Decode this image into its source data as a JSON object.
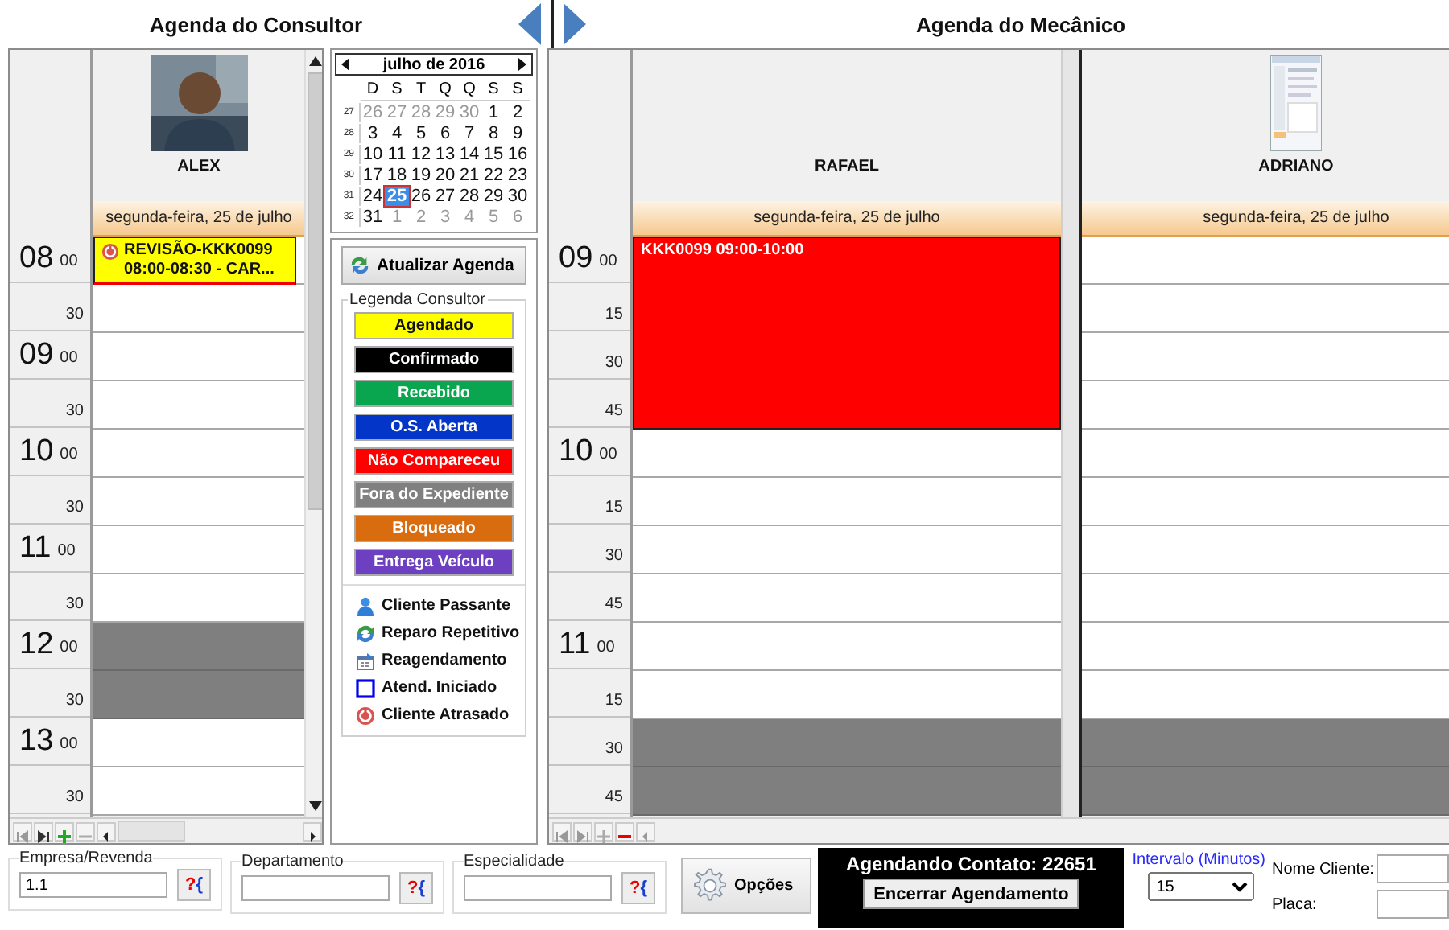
{
  "header": {
    "left_title": "Agenda do Consultor",
    "right_title": "Agenda do Mecânico"
  },
  "consultant_agenda": {
    "times": [
      {
        "hour": "08",
        "minute": "00"
      },
      {
        "minute": "30"
      },
      {
        "hour": "09",
        "minute": "00"
      },
      {
        "minute": "30"
      },
      {
        "hour": "10",
        "minute": "00"
      },
      {
        "minute": "30"
      },
      {
        "hour": "11",
        "minute": "00"
      },
      {
        "minute": "30"
      },
      {
        "hour": "12",
        "minute": "00"
      },
      {
        "minute": "30"
      },
      {
        "hour": "13",
        "minute": "00"
      },
      {
        "minute": "30"
      }
    ],
    "resources": [
      {
        "name": "ALEX",
        "photo": true,
        "date": "segunda-feira, 25 de julho",
        "slots": [
          {
            "blocked": false,
            "appointment": {
              "title": "REVISÃO-KKK0099",
              "detail": "08:00-08:30 - CAR...",
              "color": "#ffff00",
              "late": true
            }
          },
          {
            "blocked": false
          },
          {
            "blocked": false
          },
          {
            "blocked": false
          },
          {
            "blocked": false
          },
          {
            "blocked": false
          },
          {
            "blocked": false
          },
          {
            "blocked": false
          },
          {
            "blocked": true
          },
          {
            "blocked": true
          },
          {
            "blocked": false
          },
          {
            "blocked": false
          }
        ]
      }
    ]
  },
  "calendar": {
    "month": "julho de 2016",
    "weekdays": [
      "D",
      "S",
      "T",
      "Q",
      "Q",
      "S",
      "S"
    ],
    "weeks": [
      {
        "number": "27",
        "days": [
          {
            "day": "26",
            "other_month": true,
            "selected": false
          },
          {
            "day": "27",
            "other_month": true,
            "selected": false
          },
          {
            "day": "28",
            "other_month": true,
            "selected": false
          },
          {
            "day": "29",
            "other_month": true,
            "selected": false
          },
          {
            "day": "30",
            "other_month": true,
            "selected": false
          },
          {
            "day": "1",
            "other_month": false,
            "selected": false
          },
          {
            "day": "2",
            "other_month": false,
            "selected": false
          }
        ]
      },
      {
        "number": "28",
        "days": [
          {
            "day": "3",
            "other_month": false,
            "selected": false
          },
          {
            "day": "4",
            "other_month": false,
            "selected": false
          },
          {
            "day": "5",
            "other_month": false,
            "selected": false
          },
          {
            "day": "6",
            "other_month": false,
            "selected": false
          },
          {
            "day": "7",
            "other_month": false,
            "selected": false
          },
          {
            "day": "8",
            "other_month": false,
            "selected": false
          },
          {
            "day": "9",
            "other_month": false,
            "selected": false
          }
        ]
      },
      {
        "number": "29",
        "days": [
          {
            "day": "10",
            "other_month": false,
            "selected": false
          },
          {
            "day": "11",
            "other_month": false,
            "selected": false
          },
          {
            "day": "12",
            "other_month": false,
            "selected": false
          },
          {
            "day": "13",
            "other_month": false,
            "selected": false
          },
          {
            "day": "14",
            "other_month": false,
            "selected": false
          },
          {
            "day": "15",
            "other_month": false,
            "selected": false
          },
          {
            "day": "16",
            "other_month": false,
            "selected": false
          }
        ]
      },
      {
        "number": "30",
        "days": [
          {
            "day": "17",
            "other_month": false,
            "selected": false
          },
          {
            "day": "18",
            "other_month": false,
            "selected": false
          },
          {
            "day": "19",
            "other_month": false,
            "selected": false
          },
          {
            "day": "20",
            "other_month": false,
            "selected": false
          },
          {
            "day": "21",
            "other_month": false,
            "selected": false
          },
          {
            "day": "22",
            "other_month": false,
            "selected": false
          },
          {
            "day": "23",
            "other_month": false,
            "selected": false
          }
        ]
      },
      {
        "number": "31",
        "days": [
          {
            "day": "24",
            "other_month": false,
            "selected": false
          },
          {
            "day": "25",
            "other_month": false,
            "selected": true
          },
          {
            "day": "26",
            "other_month": false,
            "selected": false
          },
          {
            "day": "27",
            "other_month": false,
            "selected": false
          },
          {
            "day": "28",
            "other_month": false,
            "selected": false
          },
          {
            "day": "29",
            "other_month": false,
            "selected": false
          },
          {
            "day": "30",
            "other_month": false,
            "selected": false
          }
        ]
      },
      {
        "number": "32",
        "days": [
          {
            "day": "31",
            "other_month": false,
            "selected": false
          },
          {
            "day": "1",
            "other_month": true,
            "selected": false
          },
          {
            "day": "2",
            "other_month": true,
            "selected": false
          },
          {
            "day": "3",
            "other_month": true,
            "selected": false
          },
          {
            "day": "4",
            "other_month": true,
            "selected": false
          },
          {
            "day": "5",
            "other_month": true,
            "selected": false
          },
          {
            "day": "6",
            "other_month": true,
            "selected": false
          }
        ]
      }
    ]
  },
  "refresh_button": "Atualizar Agenda",
  "legend": {
    "title": "Legenda Consultor",
    "statuses": [
      {
        "label": "Agendado",
        "color": "#ffff00"
      },
      {
        "label": "Confirmado",
        "color": "#000000"
      },
      {
        "label": "Recebido",
        "color": "#0aa64f"
      },
      {
        "label": "O.S. Aberta",
        "color": "#0335c8"
      },
      {
        "label": "Não Compareceu",
        "color": "#ff0000"
      },
      {
        "label": "Fora do Expediente",
        "color": "#808080"
      },
      {
        "label": "Bloqueado",
        "color": "#d96c0e"
      },
      {
        "label": "Entrega Veículo",
        "color": "#6c40c0"
      }
    ],
    "symbols": [
      {
        "kind": "person",
        "label": "Cliente Passante"
      },
      {
        "kind": "repeat",
        "label": "Reparo Repetitivo"
      },
      {
        "kind": "reschedule",
        "label": "Reagendamento"
      },
      {
        "kind": "started",
        "label": "Atend. Iniciado"
      },
      {
        "kind": "late",
        "label": "Cliente Atrasado"
      }
    ]
  },
  "mechanic_agenda": {
    "times": [
      {
        "hour": "09",
        "minute": "00"
      },
      {
        "minute": "15"
      },
      {
        "minute": "30"
      },
      {
        "minute": "45"
      },
      {
        "hour": "10",
        "minute": "00"
      },
      {
        "minute": "15"
      },
      {
        "minute": "30"
      },
      {
        "minute": "45"
      },
      {
        "hour": "11",
        "minute": "00"
      },
      {
        "minute": "15"
      },
      {
        "minute": "30"
      },
      {
        "minute": "45"
      }
    ],
    "resources": [
      {
        "name": "RAFAEL",
        "photo": false,
        "date": "segunda-feira, 25 de julho",
        "slots": [
          {
            "appointment": {
              "title": "KKK0099 09:00-10:00",
              "color": "#ff0000",
              "late": false
            }
          },
          {
            "covered": true
          },
          {
            "covered": true
          },
          {
            "covered": true
          },
          {
            "blocked": false
          },
          {
            "blocked": false
          },
          {
            "blocked": false
          },
          {
            "blocked": false
          },
          {
            "blocked": false
          },
          {
            "blocked": false
          },
          {
            "blocked": true
          },
          {
            "blocked": true
          }
        ]
      },
      {
        "name": "ADRIANO",
        "photo": true,
        "date": "segunda-feira, 25 de julho",
        "slots": [
          {
            "blocked": false
          },
          {
            "blocked": false
          },
          {
            "blocked": false
          },
          {
            "blocked": false
          },
          {
            "blocked": false
          },
          {
            "blocked": false
          },
          {
            "blocked": false
          },
          {
            "blocked": false
          },
          {
            "blocked": false
          },
          {
            "blocked": false
          },
          {
            "blocked": true
          },
          {
            "blocked": true
          }
        ]
      }
    ]
  },
  "filters": [
    {
      "label": "Empresa/Revenda",
      "value": "1.1",
      "lookup": "?{"
    },
    {
      "label": "Departamento",
      "lookup": "?{"
    },
    {
      "label": "Especialidade",
      "lookup": "?{"
    }
  ],
  "options_button": "Opções",
  "contact": {
    "text": "Agendando Contato: 22651",
    "button": "Encerrar Agendamento"
  },
  "interval": {
    "label": "Intervalo (Minutos)",
    "value": "15"
  },
  "client_name": {
    "label": "Nome Cliente:"
  },
  "plate": {
    "label": "Placa:"
  }
}
